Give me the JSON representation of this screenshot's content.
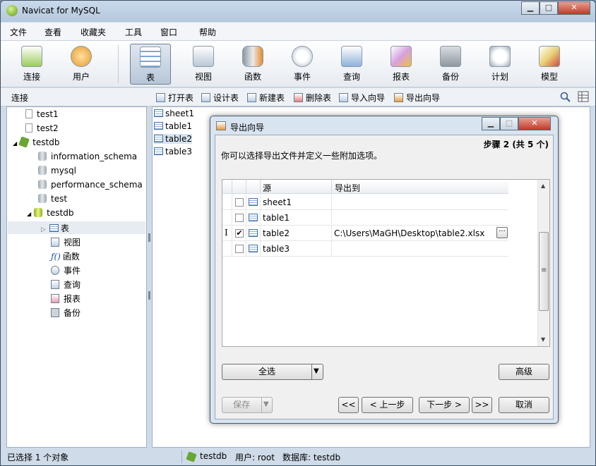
{
  "app": {
    "title": "Navicat for MySQL"
  },
  "window_controls": {
    "minimize": "▁",
    "maximize": "□",
    "close": "✕"
  },
  "menu": [
    "文件",
    "查看",
    "收藏夹",
    "工具",
    "窗口",
    "帮助"
  ],
  "toolbar": [
    {
      "label": "连接",
      "icon": "connect-icon"
    },
    {
      "label": "用户",
      "icon": "user-icon"
    },
    {
      "label": "表",
      "icon": "table-icon",
      "active": true
    },
    {
      "label": "视图",
      "icon": "view-icon"
    },
    {
      "label": "函数",
      "icon": "function-icon"
    },
    {
      "label": "事件",
      "icon": "event-icon"
    },
    {
      "label": "查询",
      "icon": "query-icon"
    },
    {
      "label": "报表",
      "icon": "report-icon"
    },
    {
      "label": "备份",
      "icon": "backup-icon"
    },
    {
      "label": "计划",
      "icon": "schedule-icon"
    },
    {
      "label": "模型",
      "icon": "model-icon"
    }
  ],
  "subtoolbar": {
    "section_label": "连接",
    "actions": [
      "打开表",
      "设计表",
      "新建表",
      "删除表",
      "导入向导",
      "导出向导"
    ]
  },
  "tree": {
    "connections": [
      "test1",
      "test2",
      "testdb"
    ],
    "databases": [
      "information_schema",
      "mysql",
      "performance_schema",
      "test",
      "testdb"
    ],
    "objects": [
      "表",
      "视图",
      "函数",
      "事件",
      "查询",
      "报表",
      "备份"
    ],
    "function_glyph": "ƒ()",
    "toggle_expanded": "◢",
    "toggle_collapsed": "▷"
  },
  "tables": [
    "sheet1",
    "table1",
    "table2",
    "table3"
  ],
  "status": {
    "selection": "已选择 1 个对象",
    "connection": "testdb",
    "user": "用户: root",
    "database": "数据库: testdb"
  },
  "dialog": {
    "title": "导出向导",
    "step": "步骤 2 (共 5 个)",
    "description": "你可以选择导出文件并定义一些附加选项。",
    "columns": {
      "source": "源",
      "export_to": "导出到"
    },
    "rows": [
      {
        "source": "sheet1",
        "checked": false,
        "export_to": ""
      },
      {
        "source": "table1",
        "checked": false,
        "export_to": ""
      },
      {
        "source": "table2",
        "checked": true,
        "export_to": "C:\\Users\\MaGH\\Desktop\\table2.xlsx"
      },
      {
        "source": "table3",
        "checked": false,
        "export_to": ""
      }
    ],
    "check_mark": "✔",
    "ellipsis": "···",
    "row_cursor": "I",
    "scroll_up": "▲",
    "scroll_down": "▼",
    "scroll_grip": "≡",
    "buttons": {
      "select_all": "全选",
      "select_all_arrow": "▼",
      "advanced": "高级",
      "save": "保存",
      "save_arrow": "▼",
      "first": "<<",
      "prev": "< 上一步",
      "next": "下一步 >",
      "last": ">>",
      "cancel": "取消"
    }
  }
}
